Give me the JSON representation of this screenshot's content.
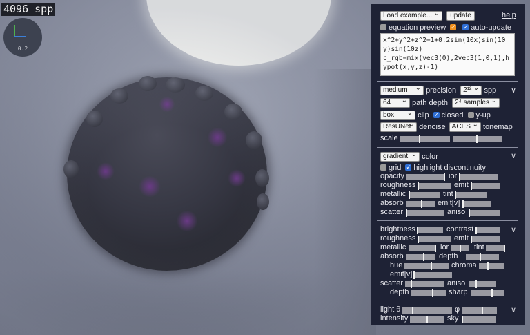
{
  "overlay": {
    "spp_counter": "4096 spp",
    "gizmo_scale": "0.2"
  },
  "panel": {
    "load_example": "Load example...",
    "update_button": "update",
    "help_link": "help",
    "equation_preview_label": "equation preview",
    "auto_update_label": "auto-update",
    "equation_text": "x^2+y^2+z^2=1+0.2sin(10x)sin(10y)sin(10z)\nc_rgb=mix(vec3(0),2vec3(1,0,1),hypot(x,y,z)-1)",
    "render": {
      "precision_value": "medium",
      "precision_label": "precision",
      "spp_value": "2¹²",
      "spp_label": "spp",
      "path_depth_value": "64",
      "path_depth_label": "path depth",
      "samples_value": "2⁴ samples",
      "clip_value": "box",
      "clip_label": "clip",
      "closed_label": "closed",
      "yup_label": "y-up",
      "denoise_value": "ResUNet",
      "denoise_label": "denoise",
      "tonemap_value": "ACES",
      "tonemap_label": "tonemap",
      "scale_label": "scale"
    },
    "material": {
      "color_value": "gradient",
      "color_label": "color",
      "grid_label": "grid",
      "highlight_label": "highlight discontinuity",
      "opacity": "opacity",
      "ior": "ior",
      "roughness": "roughness",
      "emit": "emit",
      "metallic": "metallic",
      "tint": "tint",
      "absorb": "absorb",
      "emitv": "emit[v]",
      "scatter": "scatter",
      "aniso": "aniso"
    },
    "background": {
      "brightness": "brightness",
      "contrast": "contrast",
      "roughness": "roughness",
      "emit": "emit",
      "metallic": "metallic",
      "ior": "ior",
      "tint": "tint",
      "absorb": "absorb",
      "depth": "depth",
      "hue": "hue",
      "chroma": "chroma",
      "emitv": "emit[v]",
      "scatter": "scatter",
      "aniso": "aniso",
      "depth2": "depth",
      "sharp": "sharp"
    },
    "light": {
      "theta": "light θ",
      "phi": "φ",
      "intensity": "intensity",
      "sky": "sky"
    },
    "collapse": "∨"
  }
}
